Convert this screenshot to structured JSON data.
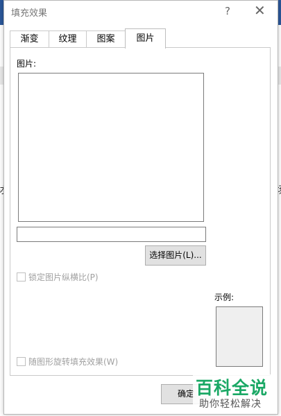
{
  "background": {
    "left_fragment": "材",
    "right_fragment": "场"
  },
  "dialog": {
    "title": "填充效果",
    "help_symbol": "?",
    "close_symbol": "✕"
  },
  "tabs": [
    {
      "label": "渐变",
      "active": false
    },
    {
      "label": "纹理",
      "active": false
    },
    {
      "label": "图案",
      "active": false
    },
    {
      "label": "图片",
      "active": true
    }
  ],
  "picture_panel": {
    "picture_label": "图片:",
    "picture_path": "",
    "select_picture_button": "选择图片(L)...",
    "lock_aspect_label": "锁定图片纵横比(P)",
    "lock_aspect_checked": false,
    "rotate_label": "随图形旋转填充效果(W)",
    "rotate_checked": false,
    "sample_label": "示例:"
  },
  "footer": {
    "ok_label": "确定"
  },
  "watermark": {
    "main": "百科全说",
    "sub": "助你轻松解决"
  }
}
